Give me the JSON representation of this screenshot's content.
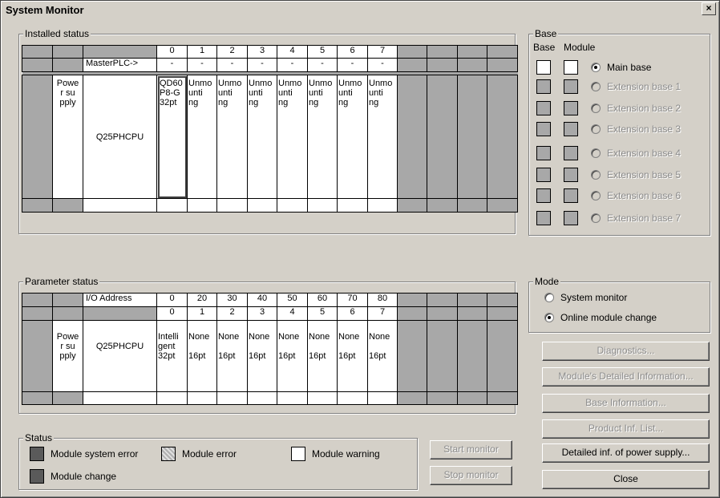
{
  "window": {
    "title": "System Monitor",
    "close_glyph": "×"
  },
  "installed": {
    "label": "Installed status",
    "slots": [
      "0",
      "1",
      "2",
      "3",
      "4",
      "5",
      "6",
      "7"
    ],
    "master_label": "MasterPLC->",
    "master_values": [
      "-",
      "-",
      "-",
      "-",
      "-",
      "-",
      "-",
      "-"
    ],
    "power": "Powe\nr su\npply",
    "cpu": "Q25PHCPU",
    "modules": [
      "QD60\nP8-G\n32pt",
      "Unmo\nunti\nng",
      "Unmo\nunti\nng",
      "Unmo\nunti\nng",
      "Unmo\nunti\nng",
      "Unmo\nunti\nng",
      "Unmo\nunti\nng",
      "Unmo\nunti\nng"
    ]
  },
  "base": {
    "label": "Base",
    "col_base": "Base",
    "col_module": "Module",
    "items": [
      {
        "label": "Main base",
        "selected": true,
        "enabled": true
      },
      {
        "label": "Extension base 1",
        "selected": false,
        "enabled": false
      },
      {
        "label": "Extension base 2",
        "selected": false,
        "enabled": false
      },
      {
        "label": "Extension base 3",
        "selected": false,
        "enabled": false
      },
      {
        "label": "Extension base 4",
        "selected": false,
        "enabled": false
      },
      {
        "label": "Extension base 5",
        "selected": false,
        "enabled": false
      },
      {
        "label": "Extension base 6",
        "selected": false,
        "enabled": false
      },
      {
        "label": "Extension base 7",
        "selected": false,
        "enabled": false
      }
    ]
  },
  "parameter": {
    "label": "Parameter status",
    "io_label": "I/O Address",
    "io_values": [
      "0",
      "20",
      "30",
      "40",
      "50",
      "60",
      "70",
      "80"
    ],
    "slots": [
      "0",
      "1",
      "2",
      "3",
      "4",
      "5",
      "6",
      "7"
    ],
    "power": "Powe\nr su\npply",
    "cpu": "Q25PHCPU",
    "modules": [
      "Intelli\ngent\n32pt",
      "None\n\n16pt",
      "None\n\n16pt",
      "None\n\n16pt",
      "None\n\n16pt",
      "None\n\n16pt",
      "None\n\n16pt",
      "None\n\n16pt"
    ]
  },
  "mode": {
    "label": "Mode",
    "options": [
      {
        "label": "System monitor",
        "selected": false
      },
      {
        "label": "Online module change",
        "selected": true
      }
    ]
  },
  "status": {
    "label": "Status",
    "system_error": "Module system error",
    "module_error": "Module error",
    "module_warning": "Module warning",
    "module_change": "Module change"
  },
  "buttons": {
    "start_monitor": "Start monitor",
    "stop_monitor": "Stop monitor",
    "diagnostics": "Diagnostics...",
    "detailed_info": "Module's Detailed Information...",
    "base_info": "Base Information...",
    "product_list": "Product Inf. List...",
    "power_supply": "Detailed inf. of power supply...",
    "close": "Close"
  }
}
